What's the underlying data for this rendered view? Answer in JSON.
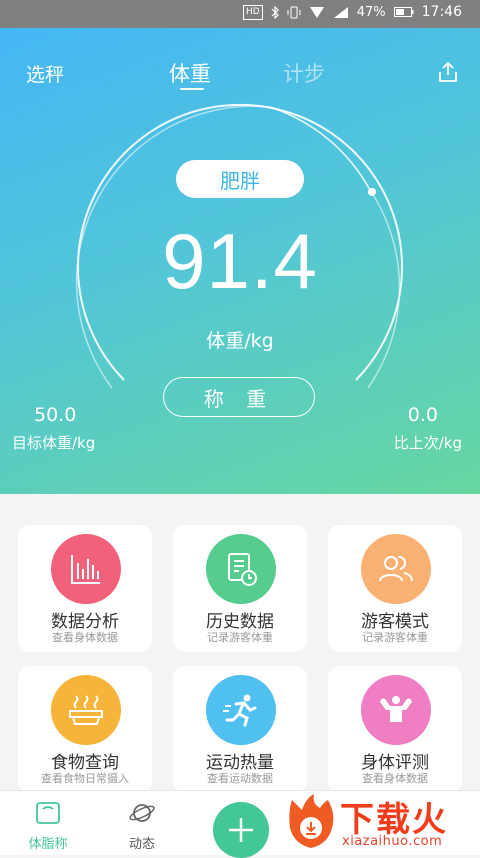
{
  "status_bar": {
    "hd": "HD",
    "battery": "47%",
    "time": "17:46"
  },
  "header": {
    "left_label": "选秤",
    "tabs": [
      {
        "label": "体重",
        "active": true
      },
      {
        "label": "计步",
        "active": false
      }
    ],
    "share_icon": "share-icon"
  },
  "gauge": {
    "status": "肥胖",
    "weight": "91.4",
    "unit": "体重/kg",
    "weigh_button": "称 重",
    "target_value": "50.0",
    "target_label": "目标体重/kg",
    "diff_value": "0.0",
    "diff_label": "比上次/kg"
  },
  "menu": [
    {
      "title": "数据分析",
      "sub": "查看身体数据",
      "color": "#f1617a",
      "icon": "chart-icon"
    },
    {
      "title": "历史数据",
      "sub": "记录游客体重",
      "color": "#56cc8f",
      "icon": "history-icon"
    },
    {
      "title": "游客模式",
      "sub": "记录游客体重",
      "color": "#f8b173",
      "icon": "guests-icon"
    },
    {
      "title": "食物查询",
      "sub": "查看食物日常摄入",
      "color": "#f7b43b",
      "icon": "food-icon"
    },
    {
      "title": "运动热量",
      "sub": "查看运动数据",
      "color": "#4fc0f0",
      "icon": "running-icon"
    },
    {
      "title": "身体评测",
      "sub": "查看身体数据",
      "color": "#f07ec3",
      "icon": "body-icon"
    }
  ],
  "tabbar": {
    "scale_label": "体脂称",
    "feed_label": "动态",
    "plus_icon": "plus-icon"
  },
  "watermark": {
    "text": "下载火",
    "url": "xiazaihuo.com"
  },
  "colors": {
    "accent": "#44c797",
    "hero_start": "#45b6f5",
    "hero_end": "#66d6a0"
  }
}
